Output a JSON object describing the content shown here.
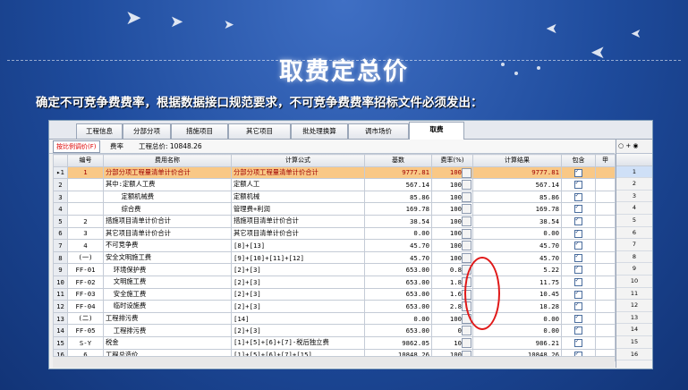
{
  "slide": {
    "title": "取费定总价",
    "subtitle": "确定不可竞争费费率，根据数据接口规范要求，不可竞争费费率招标文件必须发出："
  },
  "tabs": [
    "工程信息",
    "分部分项",
    "措施项目",
    "其它项目",
    "批处理换算",
    "调市场价",
    "取费"
  ],
  "active_tab": 6,
  "toolbar": {
    "button": "按比例调价(F)",
    "rate_label": "费率",
    "total_label": "工程总价: 10848.26"
  },
  "table": {
    "columns": [
      "",
      "编号",
      "费用名称",
      "计算公式",
      "基数",
      "费率(%)",
      "计算结果",
      "包含",
      "甲"
    ],
    "rows": [
      {
        "n": "1",
        "code": "1",
        "name": "分部分项工程量清单计价合计",
        "formula": "分部分项工程量清单计价合计",
        "base": "9777.81",
        "rate": "100",
        "result": "9777.81"
      },
      {
        "n": "2",
        "code": "",
        "name": "其中:定额人工费",
        "formula": "定额人工",
        "base": "567.14",
        "rate": "100",
        "result": "567.14"
      },
      {
        "n": "3",
        "code": "",
        "name": "定额机械费",
        "formula": "定额机械",
        "base": "85.86",
        "rate": "100",
        "result": "85.86"
      },
      {
        "n": "4",
        "code": "",
        "name": "综合费",
        "formula": "管理费+利润",
        "base": "169.78",
        "rate": "100",
        "result": "169.78"
      },
      {
        "n": "5",
        "code": "2",
        "name": "措施项目清单计价合计",
        "formula": "措施项目清单计价合计",
        "base": "38.54",
        "rate": "100",
        "result": "38.54"
      },
      {
        "n": "6",
        "code": "3",
        "name": "其它项目清单计价合计",
        "formula": "其它项目清单计价合计",
        "base": "0.00",
        "rate": "100",
        "result": "0.00"
      },
      {
        "n": "7",
        "code": "4",
        "name": "不可竞争费",
        "formula": "[8]+[13]",
        "base": "45.70",
        "rate": "100",
        "result": "45.70"
      },
      {
        "n": "8",
        "code": "(一)",
        "name": "安全文明施工费",
        "formula": "[9]+[10]+[11]+[12]",
        "base": "45.70",
        "rate": "100",
        "result": "45.70"
      },
      {
        "n": "9",
        "code": "FF-01",
        "name": "环境保护费",
        "formula": "[2]+[3]",
        "base": "653.00",
        "rate": "0.8",
        "result": "5.22"
      },
      {
        "n": "10",
        "code": "FF-02",
        "name": "文明施工费",
        "formula": "[2]+[3]",
        "base": "653.00",
        "rate": "1.8",
        "result": "11.75"
      },
      {
        "n": "11",
        "code": "FF-03",
        "name": "安全施工费",
        "formula": "[2]+[3]",
        "base": "653.00",
        "rate": "1.6",
        "result": "10.45"
      },
      {
        "n": "12",
        "code": "FF-04",
        "name": "临时设施费",
        "formula": "[2]+[3]",
        "base": "653.00",
        "rate": "2.8",
        "result": "18.28"
      },
      {
        "n": "13",
        "code": "(二)",
        "name": "工程排污费",
        "formula": "[14]",
        "base": "0.00",
        "rate": "100",
        "result": "0.00"
      },
      {
        "n": "14",
        "code": "FF-05",
        "name": "工程排污费",
        "formula": "[2]+[3]",
        "base": "653.00",
        "rate": "0",
        "result": "0.00"
      },
      {
        "n": "15",
        "code": "S-Y",
        "name": "税金",
        "formula": "[1]+[5]+[6]+[7]-税后独立费",
        "base": "9862.05",
        "rate": "10",
        "result": "986.21"
      },
      {
        "n": "16",
        "code": "6",
        "name": "工程总造价",
        "formula": "[1]+[5]+[6]+[7]+[15]",
        "base": "10848.26",
        "rate": "100",
        "result": "10848.26"
      }
    ]
  },
  "side_panel": {
    "header": "○ + ◉",
    "rows": [
      "1",
      "2",
      "3",
      "4",
      "5",
      "6",
      "7",
      "8",
      "9",
      "10",
      "11",
      "12",
      "13",
      "14",
      "15",
      "16"
    ]
  },
  "colors": {
    "selected_row": "#f9c886",
    "annotation": "#e01818"
  }
}
